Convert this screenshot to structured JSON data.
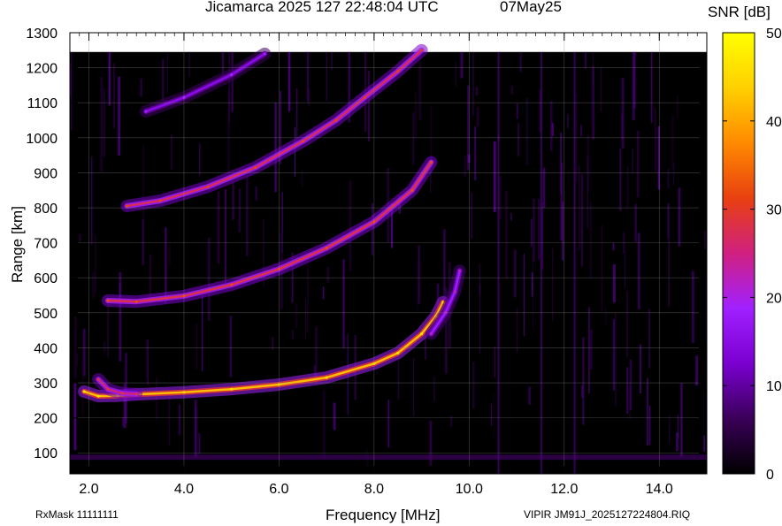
{
  "header": {
    "title": "Jicamarca 2025 127 22:48:04 UTC",
    "date": "07May25"
  },
  "footer": {
    "rxmask": "RxMask 11111111",
    "filename": "VIPIR  JM91J_2025127224804.RIQ"
  },
  "chart_data": {
    "type": "heatmap",
    "title": "Jicamarca 2025 127 22:48:04 UTC",
    "xlabel": "Frequency [MHz]",
    "ylabel": "Range [km]",
    "xlim": [
      1.6,
      15.0
    ],
    "ylim": [
      40,
      1300
    ],
    "xticks": [
      "2.0",
      "4.0",
      "6.0",
      "8.0",
      "10.0",
      "12.0",
      "14.0"
    ],
    "xtick_values": [
      2,
      4,
      6,
      8,
      10,
      12,
      14
    ],
    "yticks": [
      "100",
      "200",
      "300",
      "400",
      "500",
      "600",
      "700",
      "800",
      "900",
      "1000",
      "1100",
      "1200",
      "1300"
    ],
    "ytick_values": [
      100,
      200,
      300,
      400,
      500,
      600,
      700,
      800,
      900,
      1000,
      1100,
      1200,
      1300
    ],
    "grid": true,
    "colorbar": {
      "label": "SNR [dB]",
      "range": [
        0,
        50
      ],
      "ticks": [
        "0",
        "10",
        "20",
        "30",
        "40",
        "50"
      ],
      "tick_values": [
        0,
        10,
        20,
        30,
        40,
        50
      ],
      "colormap": [
        "#000000",
        "#3a0058",
        "#7a00d0",
        "#a020ff",
        "#d02080",
        "#e84010",
        "#ff8a00",
        "#ffd000",
        "#ffff00"
      ]
    },
    "traces": [
      {
        "name": "",
        "points": [
          [
            1.9,
            275
          ],
          [
            2.2,
            262
          ],
          [
            2.6,
            263
          ],
          [
            3.0,
            267
          ],
          [
            4.0,
            273
          ],
          [
            5.0,
            282
          ],
          [
            6.0,
            295
          ],
          [
            7.0,
            315
          ],
          [
            8.0,
            355
          ],
          [
            8.5,
            385
          ],
          [
            9.0,
            440
          ],
          [
            9.3,
            490
          ],
          [
            9.45,
            530
          ]
        ],
        "peak_snr": 42
      },
      {
        "name": "",
        "points": [
          [
            2.2,
            310
          ],
          [
            2.4,
            282
          ],
          [
            2.7,
            270
          ],
          [
            3.0,
            268
          ]
        ],
        "peak_snr": 25
      },
      {
        "name": "",
        "points": [
          [
            9.2,
            440
          ],
          [
            9.5,
            500
          ],
          [
            9.7,
            560
          ],
          [
            9.8,
            620
          ]
        ],
        "peak_snr": 18
      },
      {
        "name": "",
        "points": [
          [
            2.4,
            535
          ],
          [
            3.0,
            532
          ],
          [
            4.0,
            548
          ],
          [
            5.0,
            580
          ],
          [
            6.0,
            625
          ],
          [
            7.0,
            685
          ],
          [
            8.0,
            760
          ],
          [
            8.8,
            850
          ],
          [
            9.2,
            930
          ]
        ],
        "peak_snr": 28
      },
      {
        "name": "",
        "points": [
          [
            2.8,
            805
          ],
          [
            3.5,
            820
          ],
          [
            4.5,
            860
          ],
          [
            5.5,
            915
          ],
          [
            6.5,
            990
          ],
          [
            7.2,
            1050
          ],
          [
            7.8,
            1115
          ],
          [
            8.5,
            1190
          ],
          [
            9.0,
            1250
          ]
        ],
        "peak_snr": 27
      },
      {
        "name": "",
        "points": [
          [
            3.2,
            1075
          ],
          [
            4.0,
            1115
          ],
          [
            5.0,
            1180
          ],
          [
            5.7,
            1240
          ]
        ],
        "peak_snr": 15
      }
    ]
  }
}
